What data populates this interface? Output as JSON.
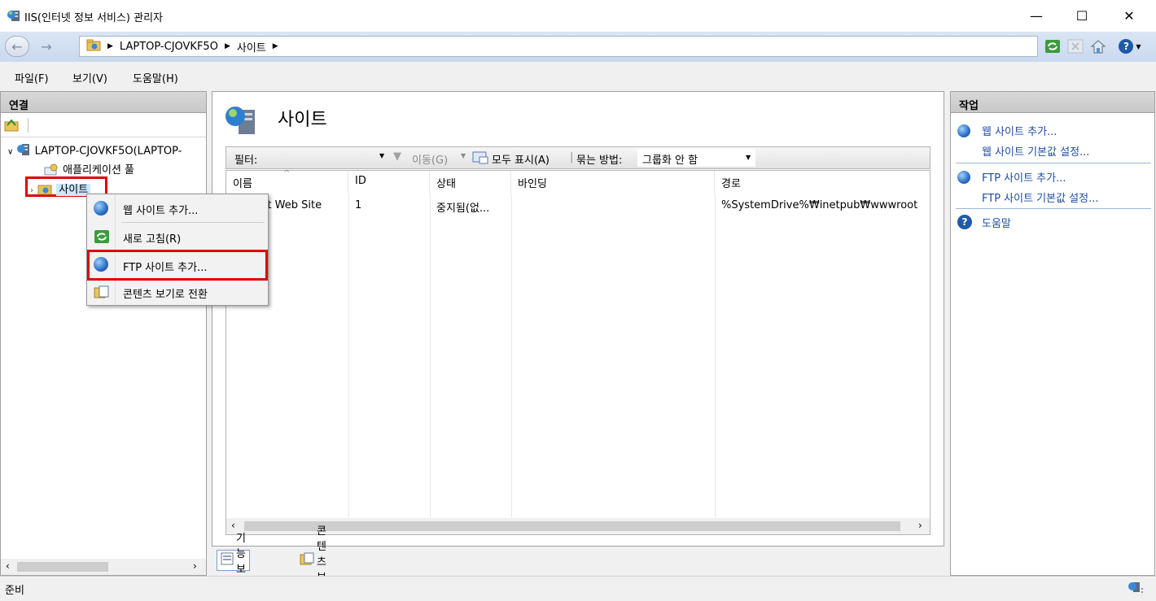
{
  "window": {
    "title": "IIS(인터넷 정보 서비스) 관리자",
    "minimize": "—",
    "maximize": "☐",
    "close": "✕"
  },
  "nav": {
    "breadcrumb": [
      "LAPTOP-CJOVKF5O",
      "사이트"
    ],
    "help_label": "?"
  },
  "menubar": {
    "items": [
      "파일(F)",
      "보기(V)",
      "도움말(H)"
    ]
  },
  "connections": {
    "header": "연결",
    "tree": {
      "server": "LAPTOP-CJOVKF5O(LAPTOP-",
      "app_pools": "애플리케이션 풀",
      "sites": "사이트"
    }
  },
  "main": {
    "title": "사이트",
    "filter": {
      "label": "필터:",
      "value": "",
      "go_label": "이동(G)",
      "show_all": "모두 표시(A)",
      "group_by_label": "묶는 방법:",
      "group_by_value": "그룹화 안 함"
    },
    "columns": [
      "이름",
      "ID",
      "상태",
      "바인딩",
      "경로"
    ],
    "rows": [
      {
        "name": "Default Web Site",
        "id": "1",
        "status": "중지됨(없...",
        "binding": "",
        "path": "%SystemDrive%₩inetpub₩wwwroot"
      }
    ],
    "view_tabs": [
      "기능 보기",
      "콘텐츠 보기"
    ]
  },
  "context_menu": {
    "items": [
      "웹 사이트 추가...",
      "새로 고침(R)",
      "FTP 사이트 추가...",
      "콘텐츠 보기로 전환"
    ]
  },
  "actions": {
    "header": "작업",
    "items": [
      "웹 사이트 추가...",
      "웹 사이트 기본값 설정...",
      "FTP 사이트 추가...",
      "FTP 사이트 기본값 설정...",
      "도움말"
    ]
  },
  "status": {
    "text": "준비"
  },
  "colors": {
    "highlight_box": "#e00000",
    "link": "#1f4ca3"
  }
}
